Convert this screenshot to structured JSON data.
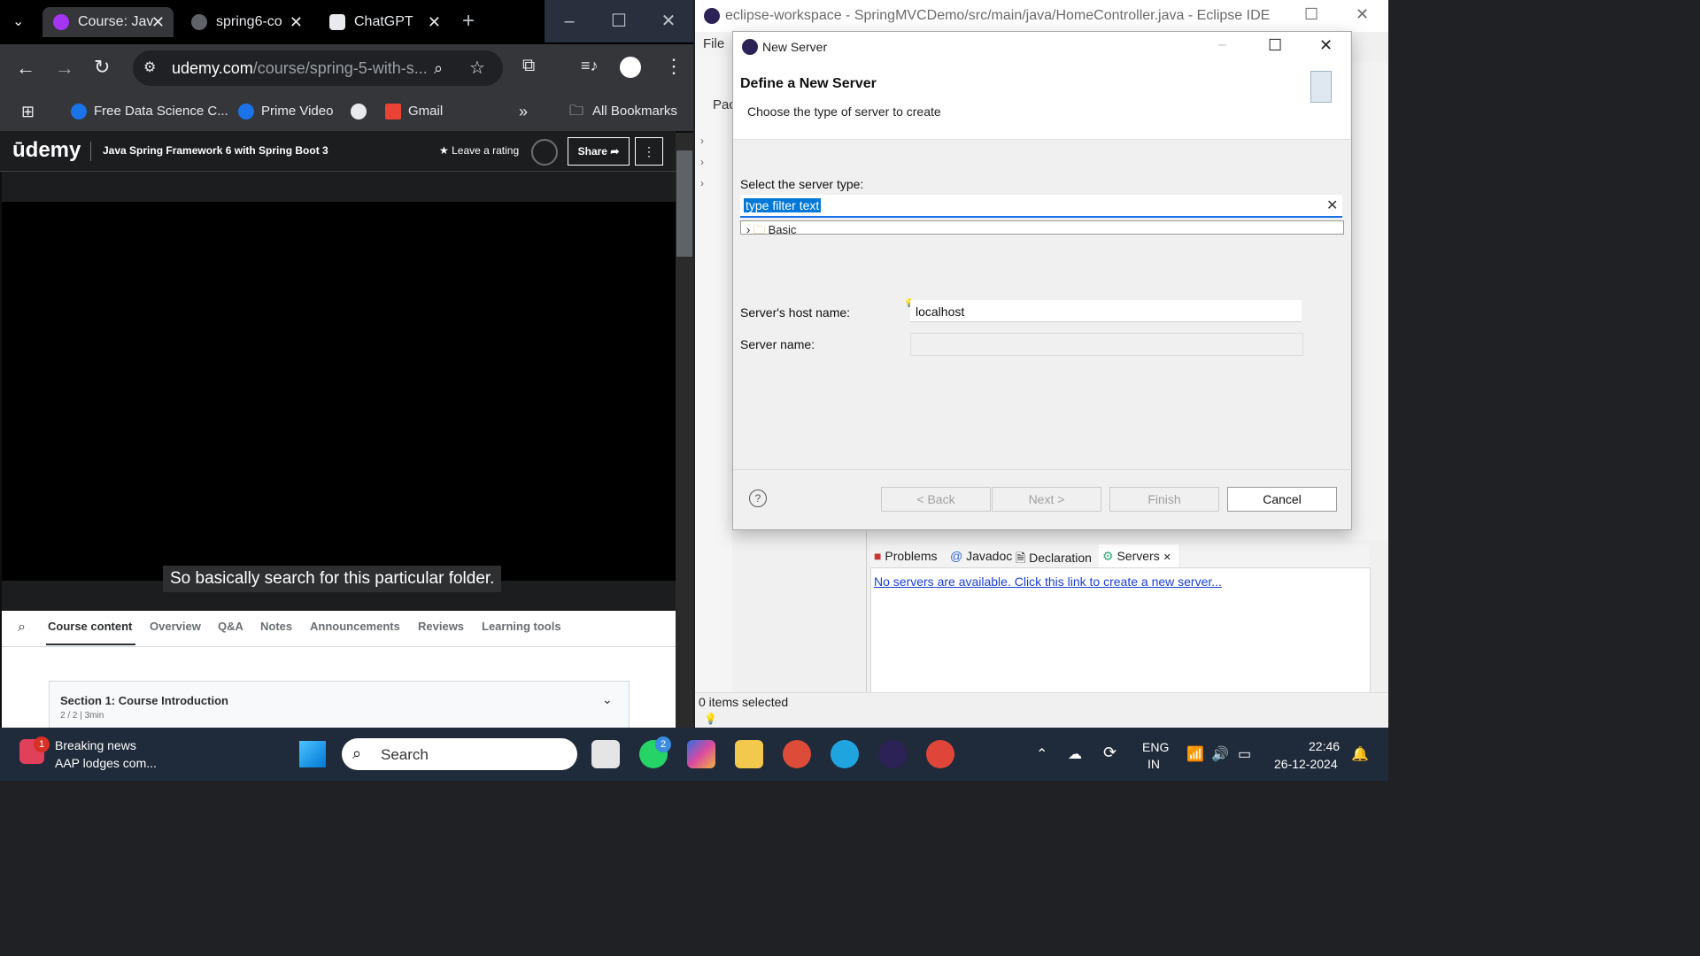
{
  "chrome": {
    "tabs": [
      {
        "label": "Course: Jav",
        "active": true,
        "icon_color": "#a435f0"
      },
      {
        "label": "spring6-co",
        "active": false,
        "icon_color": "#e8eaed"
      },
      {
        "label": "ChatGPT",
        "active": false,
        "icon_color": "#e8eaed"
      }
    ],
    "url_domain": "udemy.com",
    "url_path": "/course/spring-5-with-s...",
    "bookmarks": [
      "Free Data Science C...",
      "Prime Video",
      "Gmail"
    ],
    "all_bookmarks": "All Bookmarks"
  },
  "udemy": {
    "logo": "ūdemy",
    "course_title": "Java Spring Framework 6 with Spring Boot 3",
    "rating": "Leave a rating",
    "share": "Share",
    "caption": "So basically search for this particular folder.",
    "tabs": [
      "Course content",
      "Overview",
      "Q&A",
      "Notes",
      "Announcements",
      "Reviews",
      "Learning tools"
    ],
    "section_title": "Section 1: Course Introduction",
    "section_meta": "2 / 2 | 3min"
  },
  "eclipse": {
    "title": "eclipse-workspace - SpringMVCDemo/src/main/java/HomeController.java - Eclipse IDE",
    "menu_file": "File",
    "package_tab": "Pac",
    "views": [
      "Problems",
      "Javadoc",
      "Declaration",
      "Servers"
    ],
    "servers_link": "No servers are available. Click this link to create a new server...",
    "status": "0 items selected"
  },
  "dialog": {
    "title": "New Server",
    "heading": "Define a New Server",
    "subheading": "Choose the type of server to create",
    "select_label": "Select the server type:",
    "filter_text": "type filter text",
    "tree_item": "Basic",
    "host_label": "Server's host name:",
    "host_value": "localhost",
    "name_label": "Server name:",
    "name_value": "",
    "buttons": {
      "back": "< Back",
      "next": "Next >",
      "finish": "Finish",
      "cancel": "Cancel"
    }
  },
  "taskbar": {
    "news_badge": "1",
    "news_title": "Breaking news",
    "news_sub": "AAP lodges com...",
    "search": "Search",
    "whatsapp_badge": "2",
    "lang1": "ENG",
    "lang2": "IN",
    "time": "22:46",
    "date": "26-12-2024"
  }
}
